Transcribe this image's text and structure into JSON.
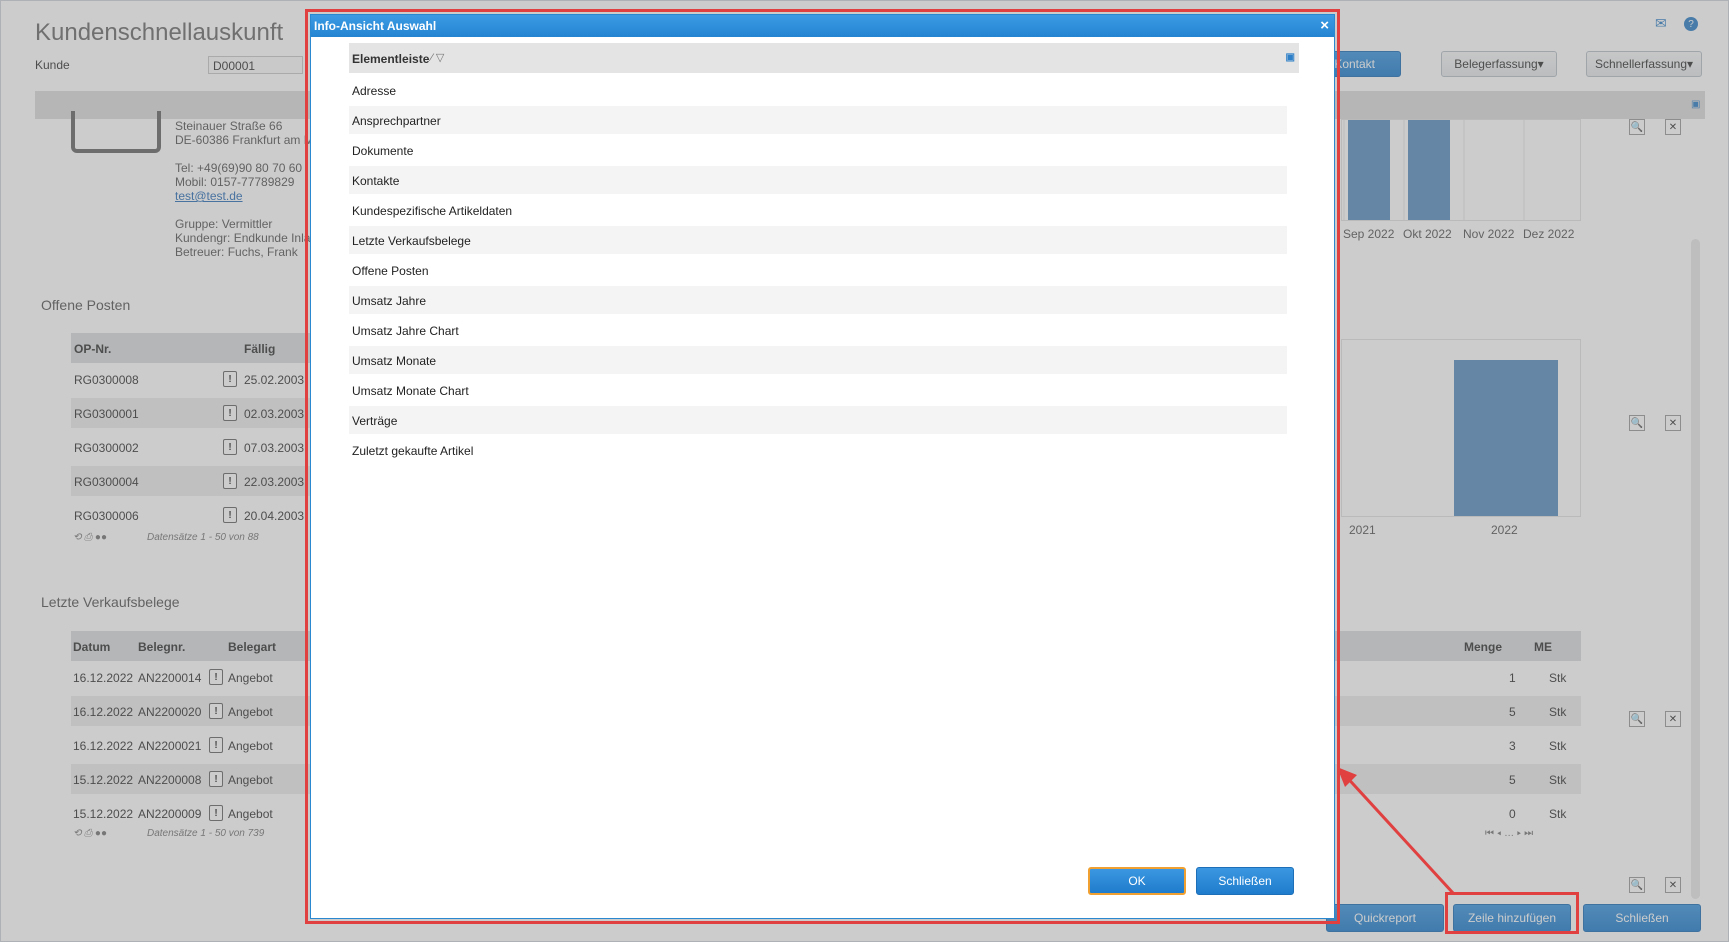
{
  "app": {
    "title": "Kundenschnellauskunft",
    "kunde_label": "Kunde",
    "kunde_value": "D00001",
    "buttons": {
      "kontakt": "r Kontakt",
      "belegerfassung": "Belegerfassung",
      "schnellerfassung": "Schnellerfassung"
    }
  },
  "address": {
    "street": "Steinauer Straße 66",
    "city": "DE-60386 Frankfurt am M",
    "tel": "Tel: +49(69)90 80 70 60",
    "mobil": "Mobil: 0157-77789829",
    "email": "test@test.de",
    "gruppe": "Gruppe: Vermittler",
    "kundengr": "Kundengr: Endkunde Inla",
    "betreuer": "Betreuer: Fuchs, Frank"
  },
  "offene_posten": {
    "title": "Offene Posten",
    "col_opnr": "OP-Nr.",
    "col_faellig": "Fällig",
    "rows": [
      {
        "opnr": "RG0300008",
        "date": "25.02.2003"
      },
      {
        "opnr": "RG0300001",
        "date": "02.03.2003"
      },
      {
        "opnr": "RG0300002",
        "date": "07.03.2003"
      },
      {
        "opnr": "RG0300004",
        "date": "22.03.2003"
      },
      {
        "opnr": "RG0300006",
        "date": "20.04.2003"
      }
    ],
    "footer": "Datensätze 1 - 50 von 88"
  },
  "verkaufsbelege": {
    "title": "Letzte Verkaufsbelege",
    "col_datum": "Datum",
    "col_belegnr": "Belegnr.",
    "col_belegart": "Belegart",
    "col_menge": "Menge",
    "col_me": "ME",
    "rows": [
      {
        "datum": "16.12.2022",
        "belegnr": "AN2200014",
        "art": "Angebot",
        "menge": "1",
        "me": "Stk"
      },
      {
        "datum": "16.12.2022",
        "belegnr": "AN2200020",
        "art": "Angebot",
        "menge": "5",
        "me": "Stk"
      },
      {
        "datum": "16.12.2022",
        "belegnr": "AN2200021",
        "art": "Angebot",
        "menge": "3",
        "me": "Stk"
      },
      {
        "datum": "15.12.2022",
        "belegnr": "AN2200008",
        "art": "Angebot",
        "menge": "5",
        "me": "Stk"
      },
      {
        "datum": "15.12.2022",
        "belegnr": "AN2200009",
        "art": "Angebot",
        "menge": "0",
        "me": "Stk"
      }
    ],
    "footer": "Datensätze 1 - 50 von 739"
  },
  "chart_data": [
    {
      "type": "bar",
      "categories": [
        "Sep 2022",
        "Okt 2022",
        "Nov 2022",
        "Dez 2022"
      ],
      "visible_partial": true
    },
    {
      "type": "bar",
      "categories": [
        "2021",
        "2022"
      ],
      "visible_partial": true
    }
  ],
  "bottom_buttons": {
    "quickreport": "Quickreport",
    "zeile": "Zeile hinzufügen",
    "schliessen": "Schließen"
  },
  "dialog": {
    "title": "Info-Ansicht Auswahl",
    "close_glyph": "×",
    "column_header": "Elementleiste",
    "items": [
      "Adresse",
      "Ansprechpartner",
      "Dokumente",
      "Kontakte",
      "Kundespezifische Artikeldaten",
      "Letzte Verkaufsbelege",
      "Offene Posten",
      "Umsatz Jahre",
      "Umsatz Jahre Chart",
      "Umsatz Monate",
      "Umsatz Monate Chart",
      "Verträge",
      "Zuletzt gekaufte Artikel"
    ],
    "ok_label": "OK",
    "close_label": "Schließen"
  },
  "colors": {
    "accent": "#2484d2",
    "highlight": "#e04040",
    "bar": "#5b8fc0"
  }
}
